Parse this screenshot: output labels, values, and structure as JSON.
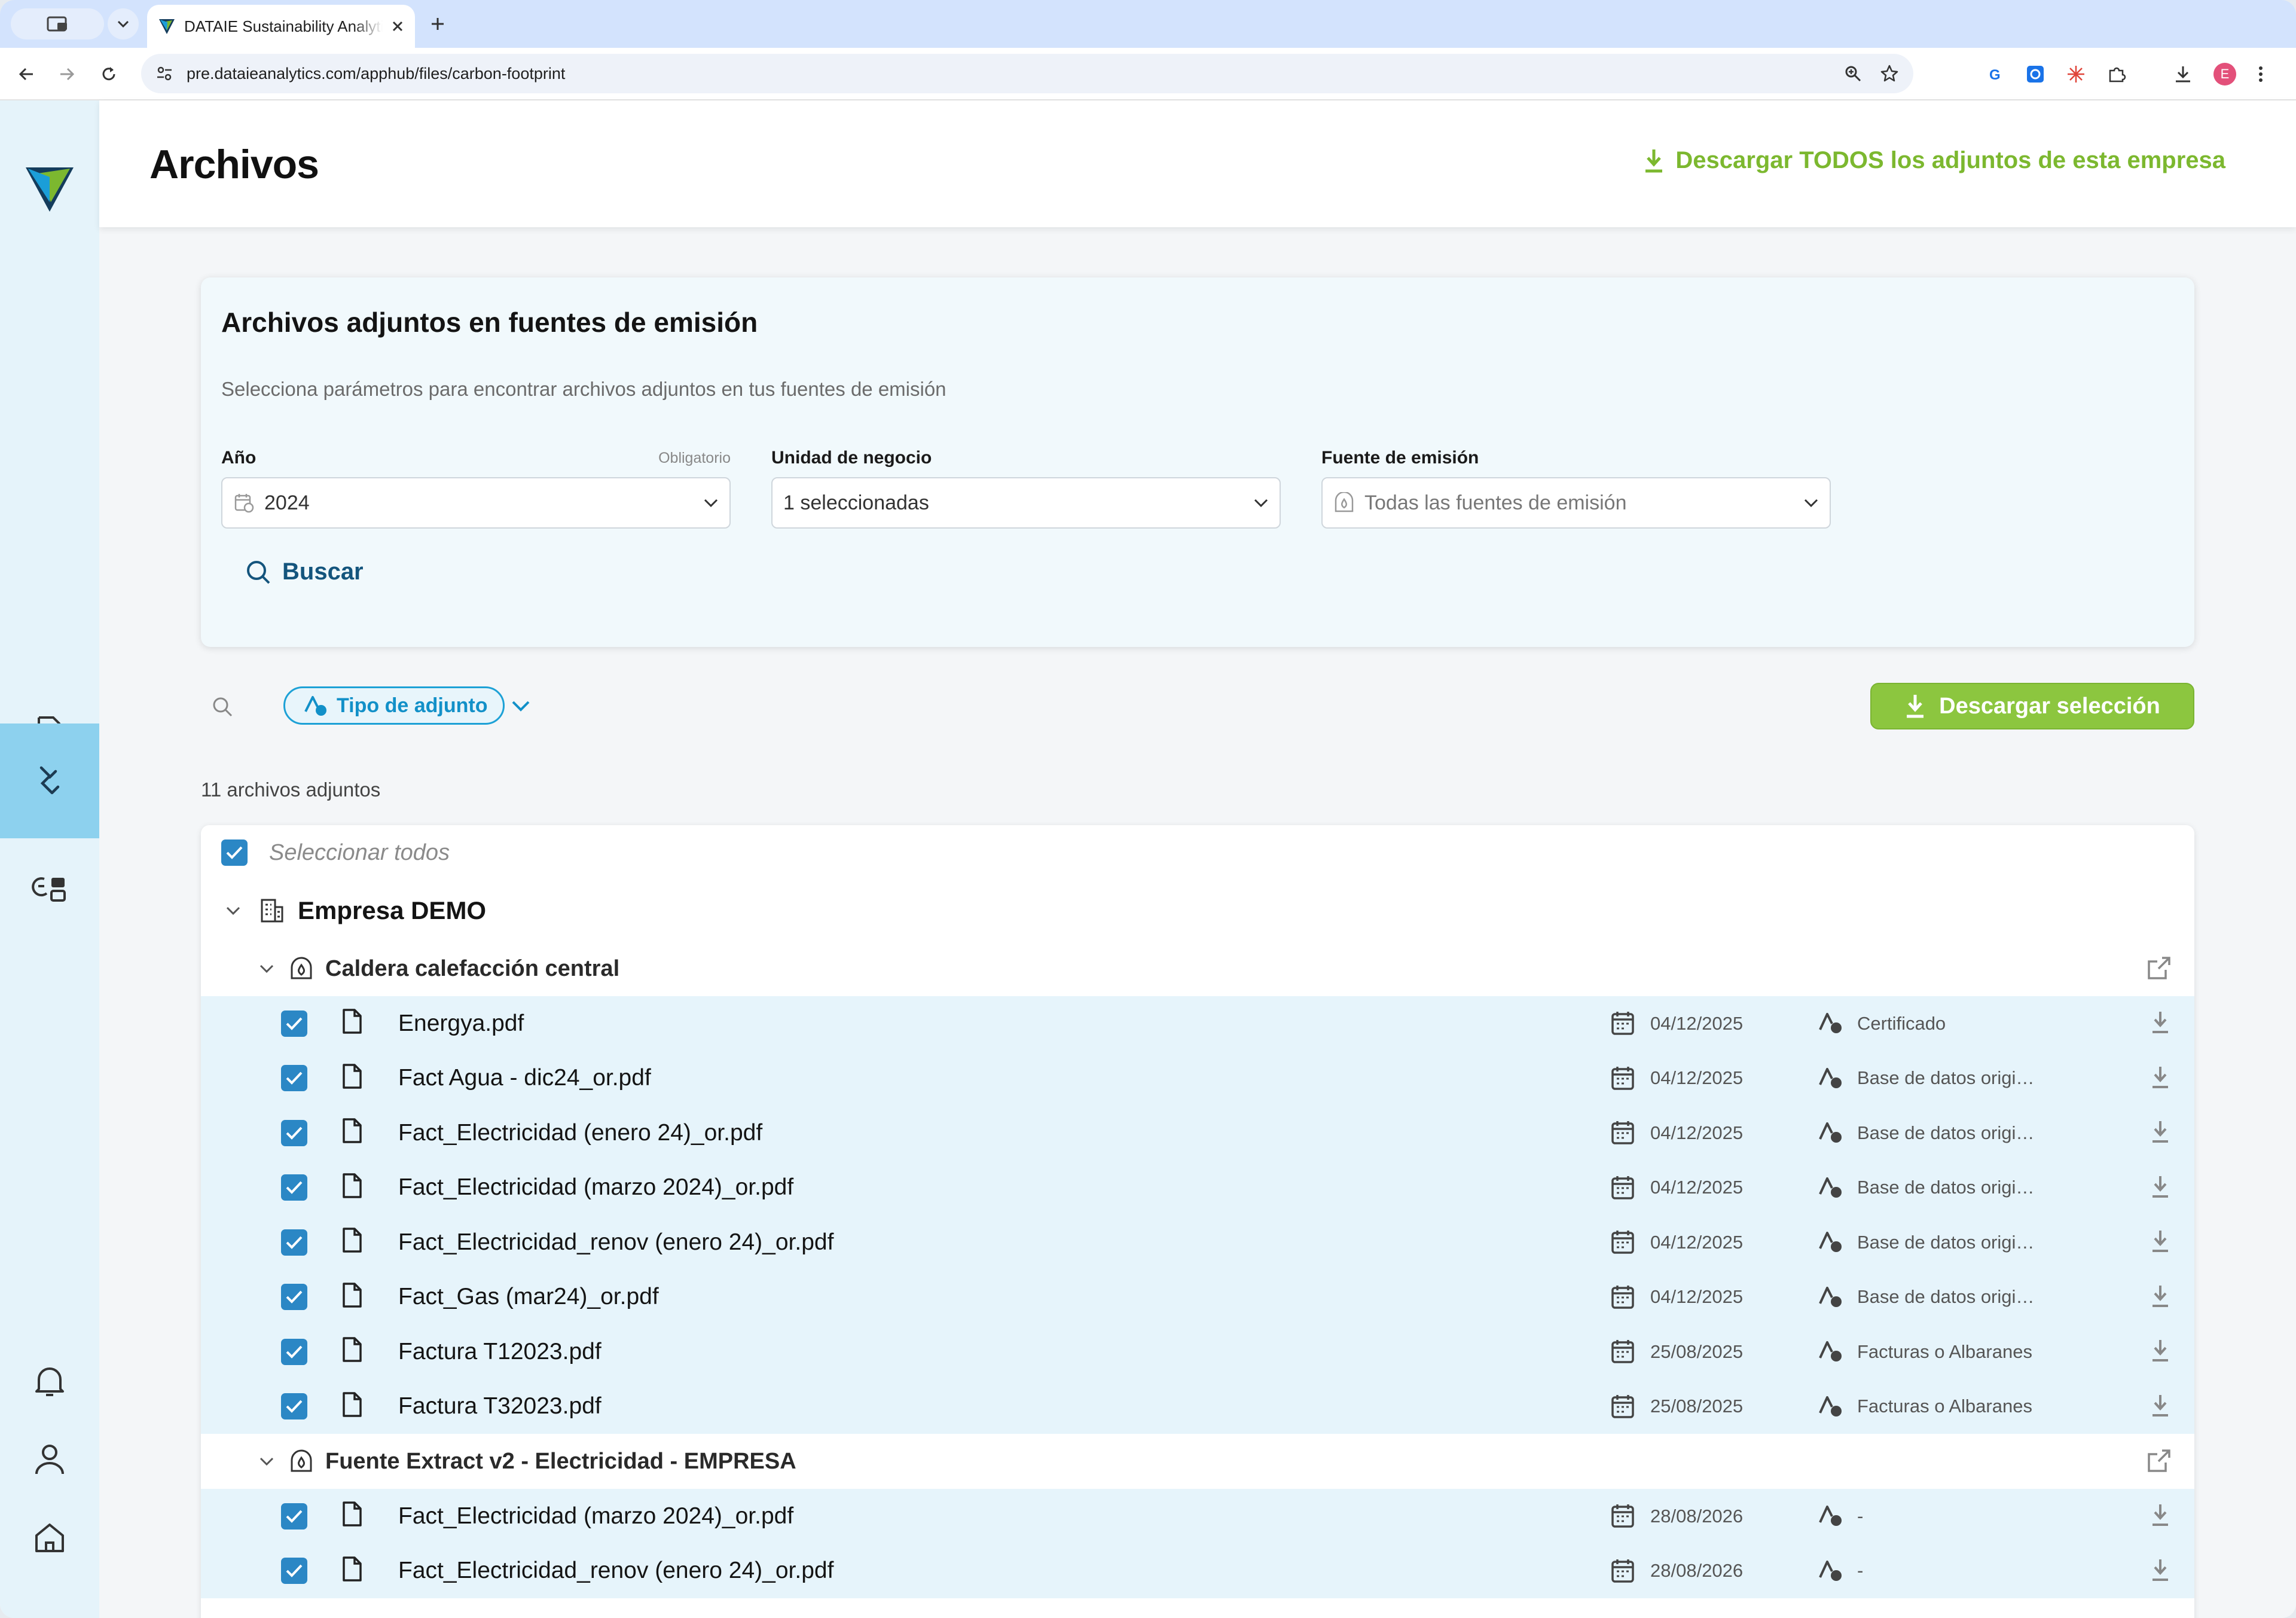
{
  "browser": {
    "tab_title": "DATAIE Sustainability Analytics",
    "url": "pre.dataieanalytics.com/apphub/files/carbon-footprint",
    "profile_initial": "E"
  },
  "header": {
    "title": "Archivos",
    "download_all": "Descargar TODOS los adjuntos de esta empresa"
  },
  "filters": {
    "title": "Archivos adjuntos en fuentes de emisión",
    "subtitle": "Selecciona parámetros para encontrar archivos adjuntos en tus fuentes de emisión",
    "year": {
      "label": "Año",
      "required": "Obligatorio",
      "value": "2024"
    },
    "business_unit": {
      "label": "Unidad de negocio",
      "value": "1 seleccionadas"
    },
    "emission_source": {
      "label": "Fuente de emisión",
      "placeholder": "Todas las fuentes de emisión"
    },
    "search_button": "Buscar"
  },
  "toolbar": {
    "attachment_type": "Tipo de adjunto",
    "download_selection": "Descargar selección"
  },
  "results": {
    "count": "11 archivos adjuntos",
    "select_all": "Seleccionar todos",
    "company": "Empresa DEMO",
    "groups": [
      {
        "name": "Caldera calefacción central",
        "files": [
          {
            "name": "Energya.pdf",
            "date": "04/12/2025",
            "type": "Certificado"
          },
          {
            "name": "Fact Agua - dic24_or.pdf",
            "date": "04/12/2025",
            "type": "Base de datos original de ERP ..."
          },
          {
            "name": "Fact_Electricidad (enero 24)_or.pdf",
            "date": "04/12/2025",
            "type": "Base de datos original de ERP ..."
          },
          {
            "name": "Fact_Electricidad (marzo 2024)_or.pdf",
            "date": "04/12/2025",
            "type": "Base de datos original de ERP ..."
          },
          {
            "name": "Fact_Electricidad_renov (enero 24)_or.pdf",
            "date": "04/12/2025",
            "type": "Base de datos original de ERP ..."
          },
          {
            "name": "Fact_Gas (mar24)_or.pdf",
            "date": "04/12/2025",
            "type": "Base de datos original de ERP ..."
          },
          {
            "name": "Factura T12023.pdf",
            "date": "25/08/2025",
            "type": "Facturas o Albaranes"
          },
          {
            "name": "Factura T32023.pdf",
            "date": "25/08/2025",
            "type": "Facturas o Albaranes"
          }
        ]
      },
      {
        "name": "Fuente Extract v2 - Electricidad - EMPRESA",
        "files": [
          {
            "name": "Fact_Electricidad (marzo 2024)_or.pdf",
            "date": "28/08/2026",
            "type": "-"
          },
          {
            "name": "Fact_Electricidad_renov (enero 24)_or.pdf",
            "date": "28/08/2026",
            "type": "-"
          }
        ]
      }
    ]
  },
  "colors": {
    "accent_green": "#8cc63f",
    "link_blue": "#14557d",
    "checkbox_blue": "#2b87c5",
    "sidebar_bg": "#e5f3fa",
    "sidebar_active": "#8dd1ee",
    "row_bg": "#e6f4fb"
  }
}
